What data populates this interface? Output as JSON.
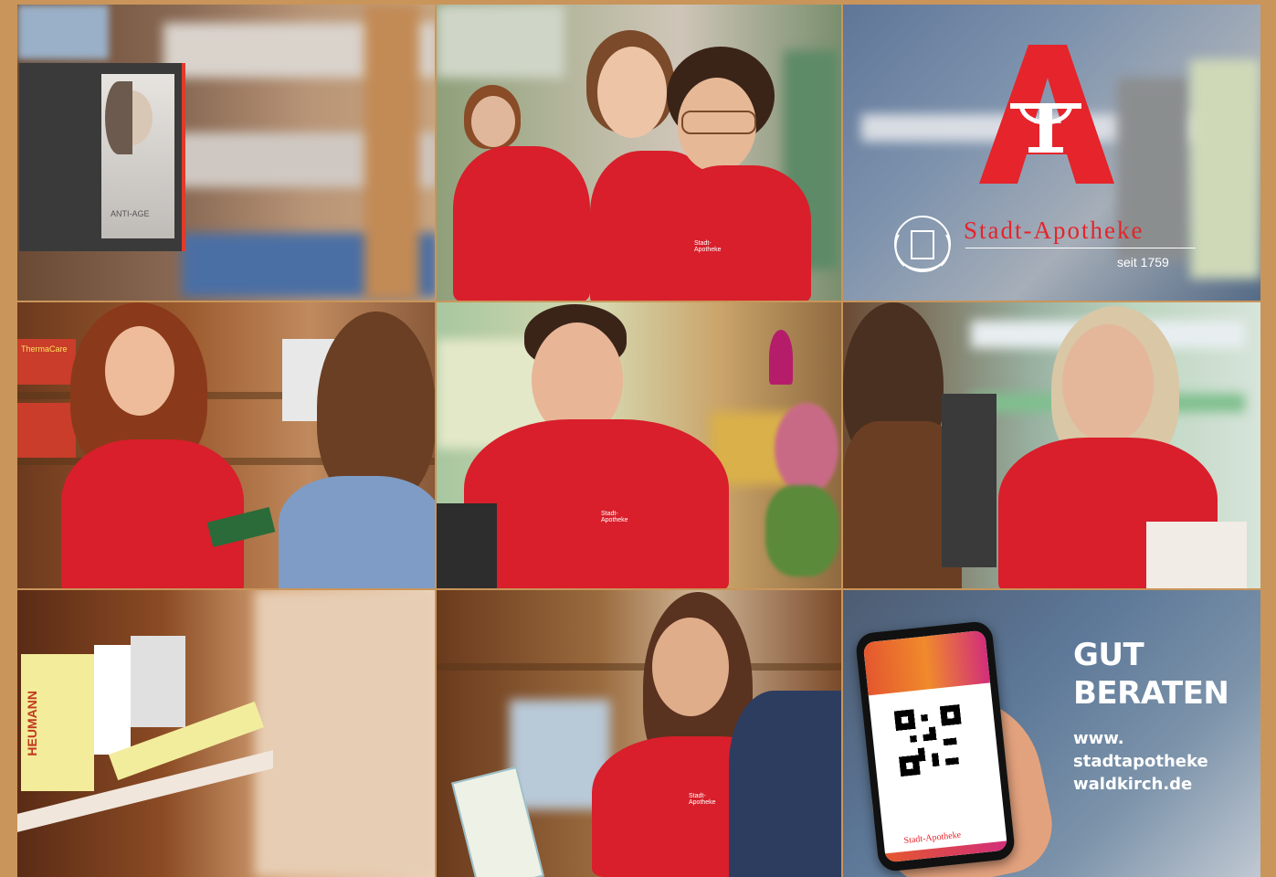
{
  "colors": {
    "frame": "#c9955a",
    "brand_red": "#e5242b",
    "shirt_red": "#d81f2b"
  },
  "tiles": [
    {
      "id": "shelf-display",
      "caption_on_display": "ANTI-AGE"
    },
    {
      "id": "team-smiling"
    },
    {
      "id": "brand",
      "name": "Stadt-Apotheke",
      "since": "seit 1759",
      "icon": "pharmacy-a-icon"
    },
    {
      "id": "advice-woman",
      "product_label": "ThermaCare"
    },
    {
      "id": "pharmacist-man"
    },
    {
      "id": "pharmacist-glasses"
    },
    {
      "id": "shelf-products",
      "box_label": "HEUMANN"
    },
    {
      "id": "pharmacist-young-woman"
    },
    {
      "id": "app-promo"
    }
  ],
  "promo": {
    "slogan_line1": "GUT",
    "slogan_line2": "BERATEN",
    "url_line1": "www.",
    "url_line2": "stadtapotheke",
    "url_line3": "waldkirch.de",
    "phone_logo": "Stadt-Apotheke"
  },
  "shirt_logo": "Stadt-Apotheke"
}
